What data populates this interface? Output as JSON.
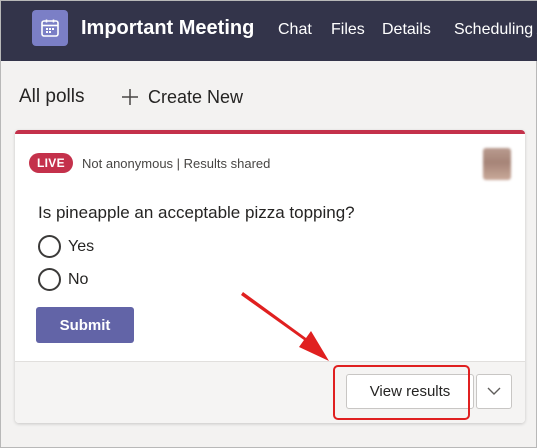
{
  "header": {
    "title": "Important Meeting",
    "tabs": [
      {
        "label": "Chat"
      },
      {
        "label": "Files"
      },
      {
        "label": "Details"
      },
      {
        "label": "Scheduling A"
      }
    ]
  },
  "toolbar": {
    "all_polls": "All polls",
    "create_new": "Create New"
  },
  "poll": {
    "status_badge": "LIVE",
    "meta": "Not anonymous | Results shared",
    "question": "Is pineapple an acceptable pizza topping?",
    "options": [
      {
        "label": "Yes",
        "selected": false
      },
      {
        "label": "No",
        "selected": false
      }
    ],
    "submit_label": "Submit",
    "view_results_label": "View results"
  },
  "colors": {
    "header_bg": "#33344a",
    "brand_accent": "#6264a7",
    "live_red": "#c4314b",
    "annotation_red": "#e02020"
  },
  "icons": [
    "calendar-icon",
    "plus-icon",
    "chevron-down-icon",
    "annotation-arrow"
  ]
}
